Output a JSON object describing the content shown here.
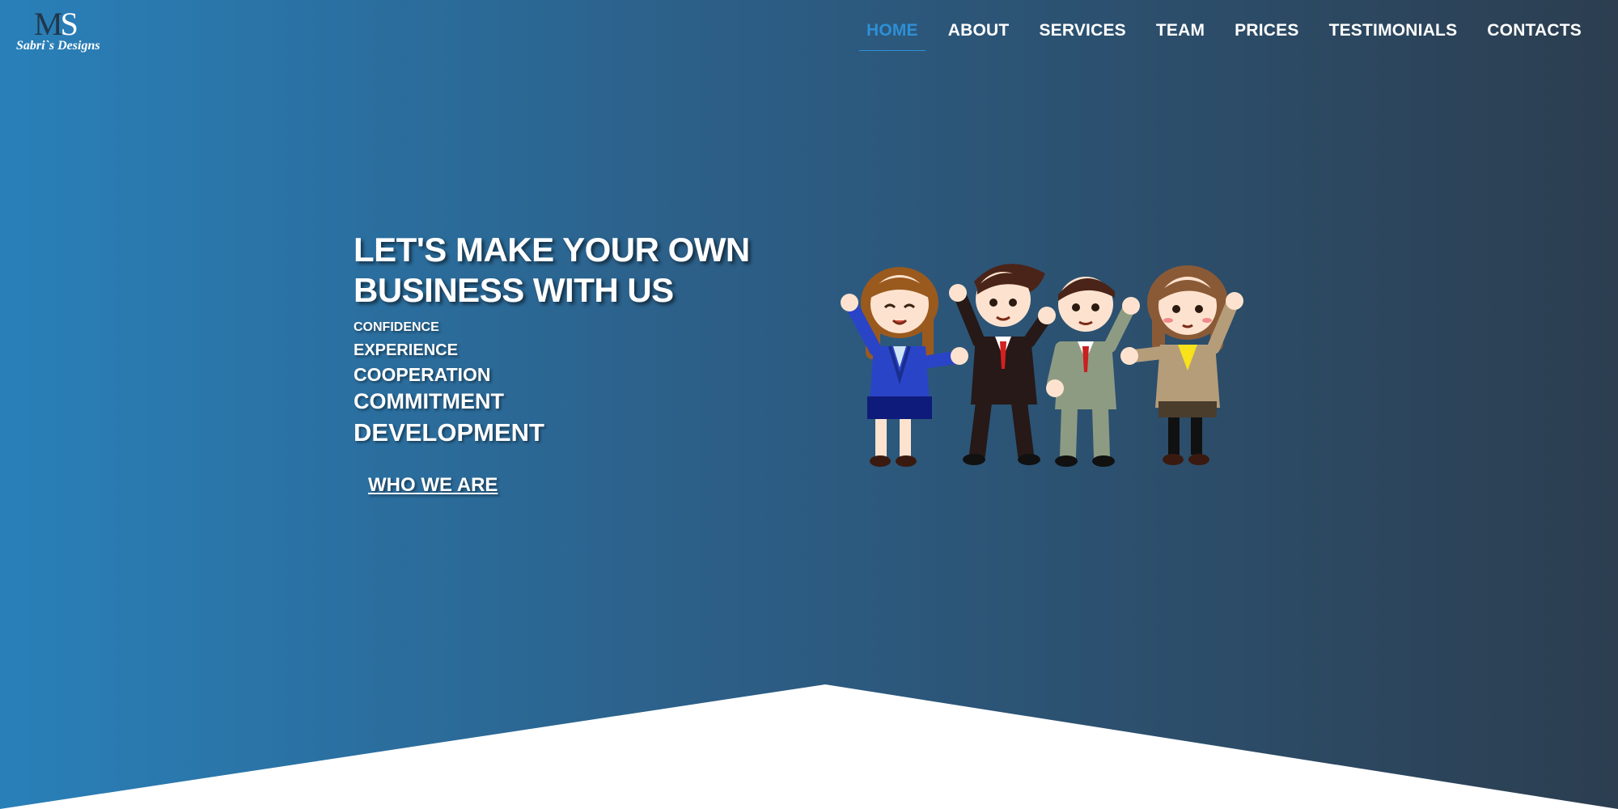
{
  "logo": {
    "mark_m": "M",
    "mark_s": "S",
    "tagline": "Sabri`s Designs"
  },
  "nav": {
    "items": [
      {
        "label": "HOME",
        "active": true
      },
      {
        "label": "ABOUT"
      },
      {
        "label": "SERVICES"
      },
      {
        "label": "TEAM"
      },
      {
        "label": "PRICES"
      },
      {
        "label": "TESTIMONIALS"
      },
      {
        "label": "CONTACTS"
      }
    ]
  },
  "hero": {
    "headline_line1": "LET'S MAKE YOUR OWN",
    "headline_line2": "BUSINESS WITH US",
    "values": [
      "CONFIDENCE",
      "EXPERIENCE",
      "COOPERATION",
      "COMMITMENT",
      "DEVELOPMENT"
    ],
    "cta_label": "WHO WE ARE"
  },
  "colors": {
    "gradient_start": "#2980b9",
    "gradient_end": "#2c3e50",
    "nav_active": "#2e8fd6",
    "text": "#ffffff"
  },
  "illustration": {
    "icon": "business-team-cheering-illustration"
  }
}
